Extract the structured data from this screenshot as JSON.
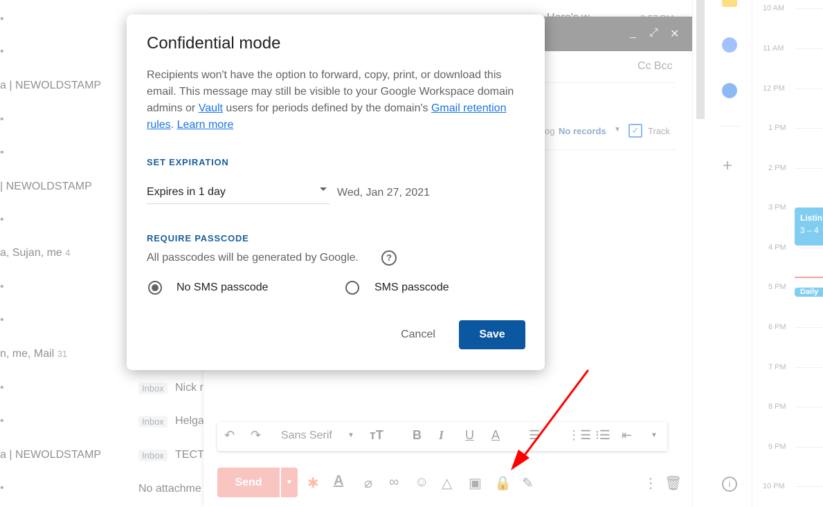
{
  "background_list": {
    "rows": [
      {
        "text": "a | NEWOLDSTAMP"
      },
      {
        "text": "| NEWOLDSTAMP"
      },
      {
        "text": "a, Sujan, me",
        "count": "4"
      },
      {
        "text": "n, me, Mail",
        "count": "31"
      },
      {
        "text": "a | NEWOLDSTAMP"
      }
    ],
    "inbox_tag": "Inbox",
    "snippets": [
      "Nick r",
      "Helga",
      "TECT"
    ],
    "no_attachments": "No attachme",
    "top_time": "3:57 PM",
    "top_snippet": "Here's w"
  },
  "compose": {
    "cc_bcc": "Cc Bcc",
    "tracking": {
      "label_prefix": "og",
      "records": "No records",
      "track_label": "Track"
    },
    "formatting": {
      "font": "Sans Serif"
    },
    "send_label": "Send"
  },
  "calendar": {
    "hours": [
      "10 AM",
      "11 AM",
      "12 PM",
      "1 PM",
      "2 PM",
      "3 PM",
      "4 PM",
      "5 PM",
      "6 PM",
      "7 PM",
      "8 PM",
      "9 PM",
      "10 PM"
    ],
    "event1_title": "Listin",
    "event1_time": "3 – 4",
    "event2_title": "Daily"
  },
  "dialog": {
    "title": "Confidential mode",
    "description_part1": "Recipients won't have the option to forward, copy, print, or download this email. This message may still be visible to your Google Workspace domain admins or ",
    "vault_link": "Vault",
    "description_part2": " users for periods defined by the domain's ",
    "retention_link": "Gmail retention rules",
    "description_part3": ". ",
    "learn_more": "Learn more",
    "set_expiration_heading": "SET EXPIRATION",
    "expiration_value": "Expires in 1 day",
    "expiration_date": "Wed, Jan 27, 2021",
    "require_passcode_heading": "REQUIRE PASSCODE",
    "passcode_help": "All passcodes will be generated by Google.",
    "option_no_sms": "No SMS passcode",
    "option_sms": "SMS passcode",
    "selected_option": "No SMS passcode",
    "cancel_label": "Cancel",
    "save_label": "Save"
  },
  "colors": {
    "primary_button": "#0b57a0",
    "section_heading": "#1a5f9e",
    "link": "#1a73e8",
    "send_button": "#f28b82",
    "annotation_arrow": "#ff0000"
  }
}
